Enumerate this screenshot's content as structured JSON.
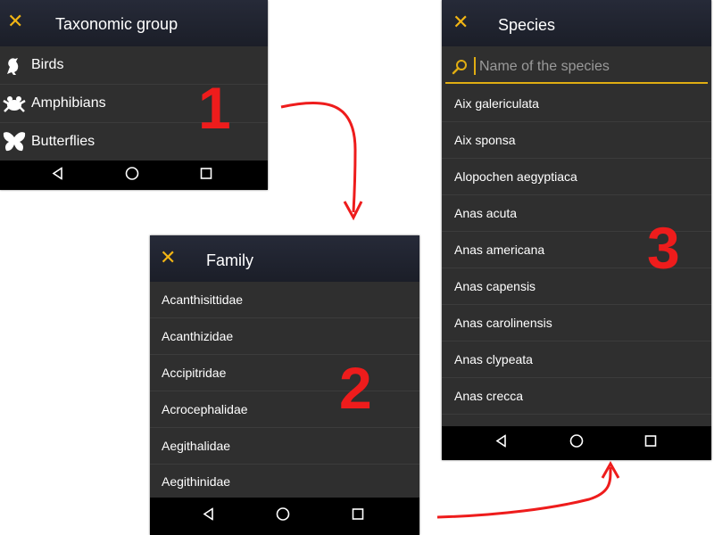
{
  "screen1": {
    "title": "Taxonomic group",
    "items": [
      {
        "label": "Birds",
        "icon": "bird-icon"
      },
      {
        "label": "Amphibians",
        "icon": "frog-icon"
      },
      {
        "label": "Butterflies",
        "icon": "butterfly-icon"
      }
    ]
  },
  "screen2": {
    "title": "Family",
    "items": [
      "Acanthisittidae",
      "Acanthizidae",
      "Accipitridae",
      "Acrocephalidae",
      "Aegithalidae",
      "Aegithinidae"
    ]
  },
  "screen3": {
    "title": "Species",
    "search_placeholder": "Name of the species",
    "items": [
      "Aix galericulata",
      "Aix sponsa",
      "Alopochen aegyptiaca",
      "Anas acuta",
      "Anas americana",
      "Anas capensis",
      "Anas carolinensis",
      "Anas clypeata",
      "Anas crecca"
    ]
  },
  "annotations": {
    "step1": "1",
    "step2": "2",
    "step3": "3"
  },
  "colors": {
    "accent": "#f2b514",
    "annotation": "#ee1c1c",
    "list_bg": "#2f2f2f",
    "nav_bg": "#000000"
  }
}
